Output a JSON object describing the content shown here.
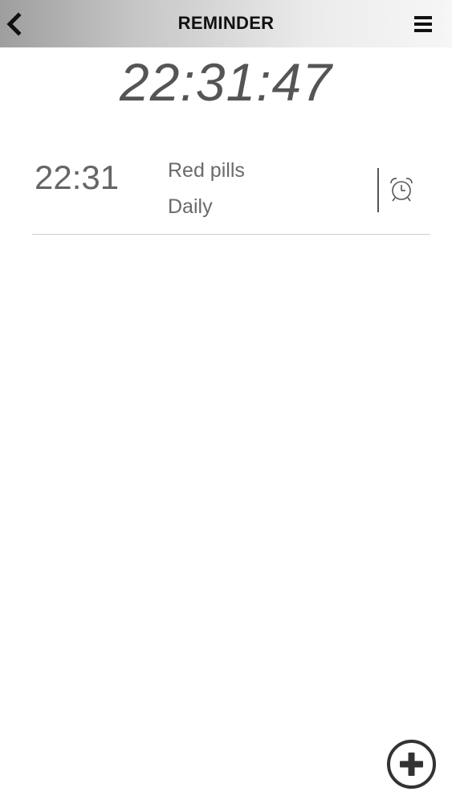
{
  "navbar": {
    "title": "REMINDER",
    "back_icon": "chevron-left-icon",
    "menu_icon": "hamburger-menu-icon"
  },
  "clock": {
    "current_time": "22:31:47"
  },
  "reminders": [
    {
      "time": "22:31",
      "label": "Red pills",
      "repeat": "Daily",
      "icon": "alarm-clock-icon"
    }
  ],
  "fab": {
    "icon": "plus-circle-icon"
  },
  "colors": {
    "text_primary": "#111111",
    "text_secondary": "#666666",
    "clock_text": "#555555",
    "divider": "#cfcfcf",
    "icon_dark": "#333333"
  }
}
